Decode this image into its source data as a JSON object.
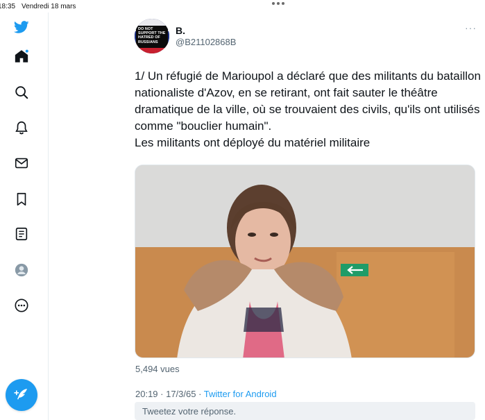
{
  "status_bar": {
    "time": "18:35",
    "date": "Vendredi 18 mars"
  },
  "sidebar": {
    "items": [
      {
        "icon": "twitter-logo-icon"
      },
      {
        "icon": "home-icon"
      },
      {
        "icon": "explore-icon"
      },
      {
        "icon": "notifications-icon"
      },
      {
        "icon": "messages-icon"
      },
      {
        "icon": "bookmarks-icon"
      },
      {
        "icon": "lists-icon"
      },
      {
        "icon": "profile-icon"
      },
      {
        "icon": "more-icon"
      }
    ],
    "compose_icon": "compose-tweet-icon"
  },
  "tweet": {
    "avatar_badge": "DO NOT SUPPORT THE HATRED OF RUSSIANS",
    "display_name": "B.",
    "handle": "@B21102868B",
    "more_label": "···",
    "text": "1/ Un réfugié de Marioupol a déclaré que des militants du bataillon nationaliste d'Azov, en se retirant, ont fait sauter le théâtre dramatique de la ville, où se trouvaient des civils, qu'ils ont utilisés comme \"bouclier humain\".\nLes militants ont déployé du matériel militaire",
    "views": "5,494 vues",
    "time": "20:19 · 17/3/65 · ",
    "source": "Twitter for Android"
  },
  "reply": {
    "placeholder": "Tweetez votre réponse."
  },
  "colors": {
    "accent": "#1d9bf0",
    "muted": "#536471"
  }
}
